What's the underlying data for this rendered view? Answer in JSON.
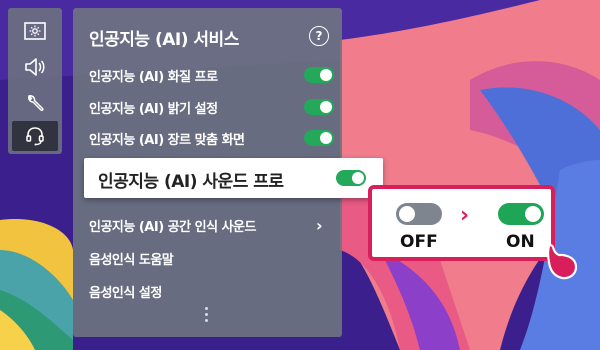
{
  "colors": {
    "toggle_on": "#24a85a",
    "toggle_off": "#7f858f",
    "callout_border": "#d81e5b",
    "panel_bg": "#6e7480"
  },
  "rail": {
    "items": [
      {
        "icon": "picture-settings-icon"
      },
      {
        "icon": "speaker-icon"
      },
      {
        "icon": "wrench-icon"
      },
      {
        "icon": "headset-icon",
        "active": true
      }
    ]
  },
  "panel": {
    "title": "인공지능 (AI) 서비스",
    "help_label": "?",
    "items": [
      {
        "label": "인공지능 (AI) 화질 프로",
        "toggle": "on"
      },
      {
        "label": "인공지능 (AI) 밝기 설정",
        "toggle": "on"
      },
      {
        "label": "인공지능 (AI) 장르 맞춤 화면",
        "toggle": "on"
      },
      {
        "label": "인공지능 (AI) 사운드 프로",
        "toggle": "on",
        "focused": true
      },
      {
        "label": "인공지능 (AI) 공간 인식 사운드",
        "has_submenu": true
      },
      {
        "label": "음성인식 도움말"
      },
      {
        "label": "음성인식 설정"
      }
    ]
  },
  "callout": {
    "off_label": "OFF",
    "on_label": "ON",
    "arrow": "›"
  }
}
